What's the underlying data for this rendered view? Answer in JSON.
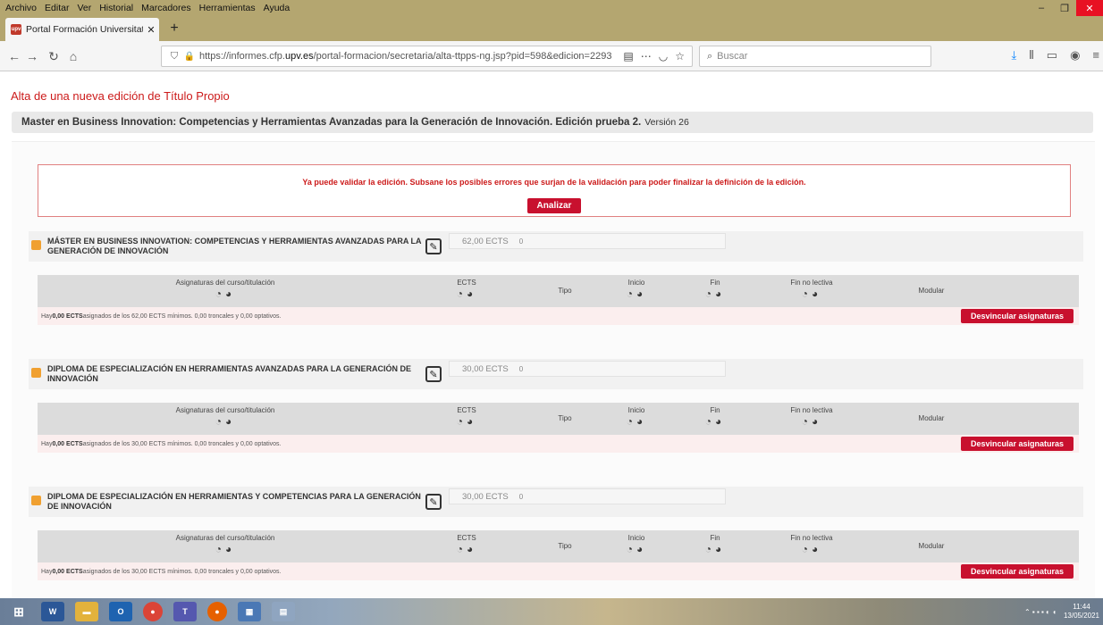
{
  "browser": {
    "menu": [
      "Archivo",
      "Editar",
      "Ver",
      "Historial",
      "Marcadores",
      "Herramientas",
      "Ayuda"
    ],
    "tab_title": "Portal Formación Universitat Po",
    "tab_favicon_text": "upv",
    "url_plain": "https://informes.cfp.",
    "url_domain": "upv.es",
    "url_path": "/portal-formacion/secretaria/alta-ttpps-ng.jsp?pid=598&edicion=2293",
    "search_placeholder": "Buscar",
    "window_min": "–",
    "window_max": "❐",
    "window_close": "✕"
  },
  "page": {
    "title": "Alta de una nueva edición de Título Propio",
    "edition_name": "Master en Business Innovation: Competencias y Herramientas Avanzadas para la Generación de Innovación. Edición prueba 2.",
    "edition_version": "Versión 26",
    "alert_message": "Ya puede validar la edición. Subsane los posibles errores que surjan de la validación para poder finalizar la definición de la edición.",
    "analyze_button": "Analizar"
  },
  "programs": [
    {
      "name": "MÁSTER EN BUSINESS INNOVATION: COMPETENCIAS Y HERRAMIENTAS AVANZADAS PARA LA GENERACIÓN DE INNOVACIÓN",
      "ects": "62,00 ECTS",
      "ects_extra": "0",
      "footer_prefix": "Hay ",
      "footer_bold": "0,00 ECTS",
      "footer_rest": " asignados de los 62,00 ECTS mínimos.    0,00 troncales y 0,00 optativos.",
      "unlink_button": "Desvincular asignaturas"
    },
    {
      "name": "DIPLOMA DE ESPECIALIZACIÓN EN HERRAMIENTAS AVANZADAS PARA LA GENERACIÓN DE INNOVACIÓN",
      "ects": "30,00 ECTS",
      "ects_extra": "0",
      "footer_prefix": "Hay ",
      "footer_bold": "0,00 ECTS",
      "footer_rest": " asignados de los 30,00 ECTS mínimos.    0,00 troncales y 0,00 optativos.",
      "unlink_button": "Desvincular asignaturas"
    },
    {
      "name": "DIPLOMA DE ESPECIALIZACIÓN EN HERRAMIENTAS Y COMPETENCIAS PARA LA GENERACIÓN DE INNOVACIÓN",
      "ects": "30,00 ECTS",
      "ects_extra": "0",
      "footer_prefix": "Hay ",
      "footer_bold": "0,00 ECTS",
      "footer_rest": " asignados de los 30,00 ECTS mínimos.    0,00 troncales y 0,00 optativos.",
      "unlink_button": "Desvincular asignaturas"
    }
  ],
  "columns": {
    "subjects": "Asignaturas del curso/titulación",
    "ects": "ECTS",
    "type": "Tipo",
    "start": "Inicio",
    "end": "Fin",
    "end_nonteaching": "Fin no lectiva",
    "modular": "Modular"
  },
  "taskbar": {
    "time": "11:44",
    "date": "13/05/2021"
  }
}
